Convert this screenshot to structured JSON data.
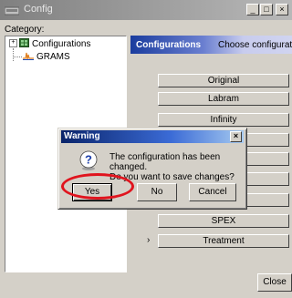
{
  "window": {
    "title": "Config",
    "minimize_glyph": "_",
    "maximize_glyph": "□",
    "close_glyph": "×"
  },
  "category": {
    "label": "Category:",
    "tree": [
      {
        "label": "Configurations",
        "icon": "grid-icon",
        "expander": "+"
      },
      {
        "label": "GRAMS",
        "icon": "waveform-icon"
      }
    ]
  },
  "panel": {
    "header_title": "Configurations",
    "header_right": "Choose configuratio",
    "buttons": [
      "Original",
      "Labram",
      "Infinity",
      "",
      "",
      "",
      "",
      "SPEX",
      "Treatment"
    ],
    "arrow": "›"
  },
  "close_button": "Close",
  "dialog": {
    "title": "Warning",
    "close_glyph": "×",
    "icon": "question-icon",
    "message_line1": "The configuration has been changed.",
    "message_line2": "Do you want to save changes?",
    "buttons": {
      "yes": "Yes",
      "no": "No",
      "cancel": "Cancel"
    }
  },
  "annotation": {
    "color": "#e0141e"
  }
}
